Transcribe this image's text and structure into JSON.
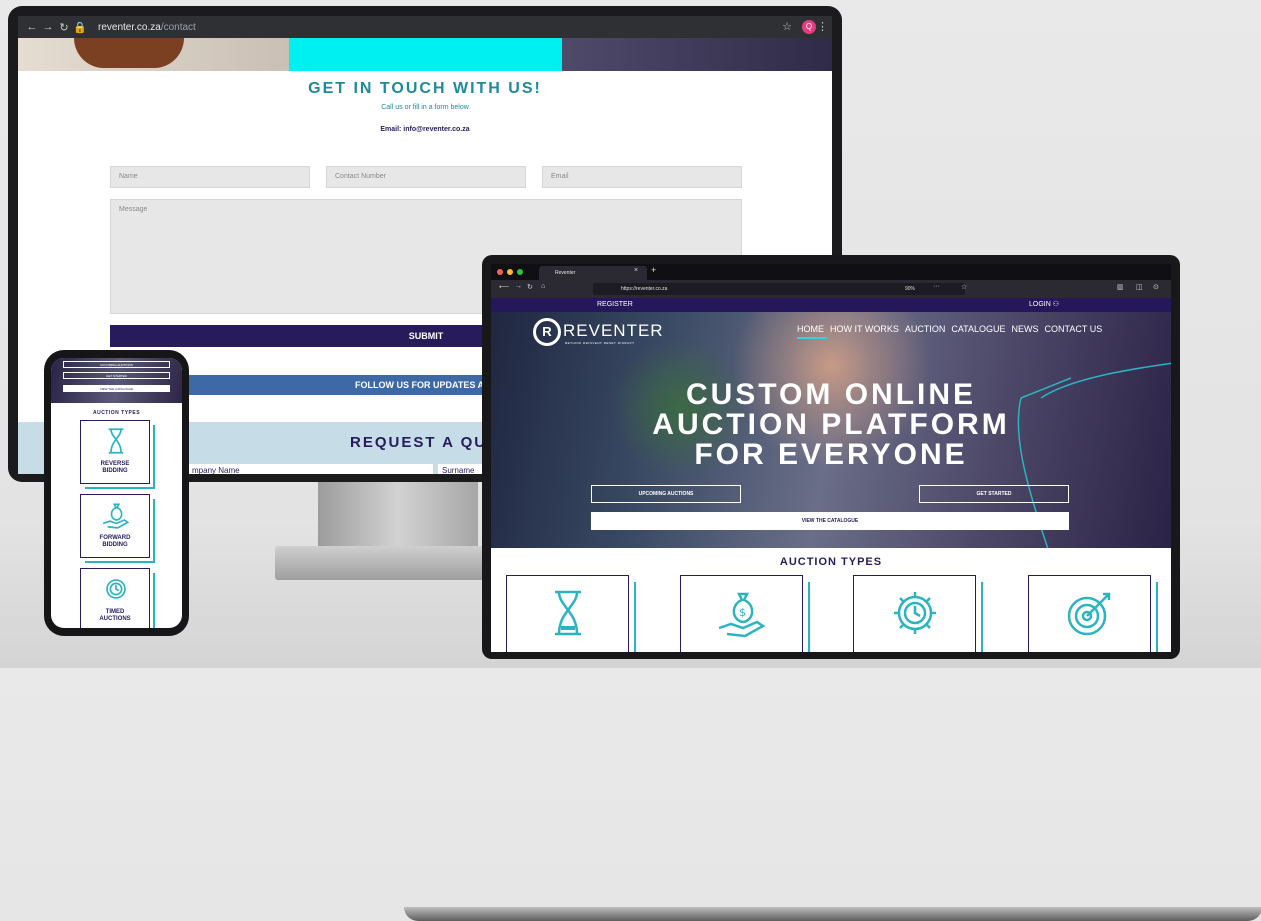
{
  "monitor": {
    "browser": {
      "url_host": "reventer.co.za",
      "url_path": "/contact",
      "avatar_letter": "Q"
    },
    "contact": {
      "title": "GET IN TOUCH WITH US!",
      "subtitle": "Call us or fill in a form below",
      "email_line": "Email: info@reventer.co.za",
      "placeholders": {
        "name": "Name",
        "contact_number": "Contact Number",
        "email": "Email",
        "message": "Message"
      },
      "submit_label": "SUBMIT",
      "follow_label": "FOLLOW US FOR UPDATES AND",
      "request_title": "REQUEST A QUC",
      "company_placeholder": "mpany Name",
      "surname_placeholder": "Surname"
    }
  },
  "laptop": {
    "browser": {
      "tab_title": "Reventer",
      "url": "https://reventer.co.za",
      "zoom": "90%"
    },
    "site": {
      "register_label": "REGISTER",
      "login_label": "LOGIN",
      "logo_text": "REVENTER",
      "logo_tagline": "RETHINK·REINVENT·RESET·DISRUPT",
      "nav": [
        "HOME",
        "HOW IT WORKS",
        "AUCTION",
        "CATALOGUE",
        "NEWS",
        "CONTACT US"
      ],
      "hero_lines": [
        "CUSTOM ONLINE",
        "AUCTION PLATFORM",
        "FOR EVERYONE"
      ],
      "buttons": {
        "upcoming": "UPCOMING AUCTIONS",
        "get_started": "GET STARTED",
        "catalogue": "VIEW THE CATALOGUE"
      },
      "auction_types_title": "AUCTION TYPES"
    }
  },
  "phone": {
    "hero_buttons": [
      "UPCOMING AUCTIONS",
      "GET STARTED",
      "VIEW THE CATALOGUE"
    ],
    "auction_types_title": "AUCTION TYPES",
    "cards": [
      {
        "label_line1": "REVERSE",
        "label_line2": "BIDDING",
        "icon": "hourglass-icon"
      },
      {
        "label_line1": "FORWARD",
        "label_line2": "BIDDING",
        "icon": "money-bag-hand-icon"
      },
      {
        "label_line1": "TIMED",
        "label_line2": "AUCTIONS",
        "icon": "clock-gear-icon"
      }
    ]
  },
  "colors": {
    "navy": "#281b5c",
    "teal": "#1c8b9a",
    "accent_teal": "#2bb4c0",
    "cyan_banner": "#00f0f2",
    "follow_blue": "#3d69a7"
  }
}
